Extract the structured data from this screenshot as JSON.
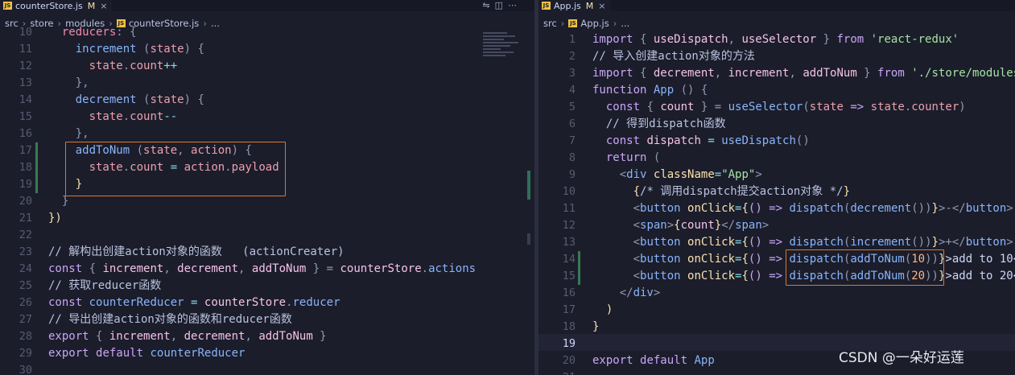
{
  "left": {
    "tab": {
      "icon": "js-icon",
      "name": "counterStore.js",
      "modified": "M",
      "close": "×"
    },
    "breadcrumb": [
      "src",
      "store",
      "modules",
      "counterStore.js",
      "..."
    ],
    "lines": [
      {
        "n": "10",
        "tokens": [
          [
            "  ",
            "t-txt"
          ],
          [
            "reducers",
            "t-obj"
          ],
          [
            ": {",
            "t-pn"
          ]
        ]
      },
      {
        "n": "11",
        "tokens": [
          [
            "    ",
            "t-txt"
          ],
          [
            "increment",
            "t-fn"
          ],
          [
            " (",
            "t-pn"
          ],
          [
            "state",
            "t-param"
          ],
          [
            ") {",
            "t-pn"
          ]
        ]
      },
      {
        "n": "12",
        "tokens": [
          [
            "      ",
            "t-txt"
          ],
          [
            "state",
            "t-param"
          ],
          [
            ".",
            "t-pn"
          ],
          [
            "count",
            "t-param"
          ],
          [
            "++",
            "t-op"
          ]
        ]
      },
      {
        "n": "13",
        "tokens": [
          [
            "    },",
            "t-pn"
          ]
        ]
      },
      {
        "n": "14",
        "tokens": [
          [
            "    ",
            "t-txt"
          ],
          [
            "decrement",
            "t-fn"
          ],
          [
            " (",
            "t-pn"
          ],
          [
            "state",
            "t-param"
          ],
          [
            ") {",
            "t-pn"
          ]
        ]
      },
      {
        "n": "15",
        "tokens": [
          [
            "      ",
            "t-txt"
          ],
          [
            "state",
            "t-param"
          ],
          [
            ".",
            "t-pn"
          ],
          [
            "count",
            "t-param"
          ],
          [
            "--",
            "t-op"
          ]
        ]
      },
      {
        "n": "16",
        "tokens": [
          [
            "    },",
            "t-pn"
          ]
        ]
      },
      {
        "n": "17",
        "tokens": [
          [
            "    ",
            "t-txt"
          ],
          [
            "addToNum",
            "t-fn"
          ],
          [
            " (",
            "t-pn"
          ],
          [
            "state",
            "t-param"
          ],
          [
            ", ",
            "t-pn"
          ],
          [
            "action",
            "t-param"
          ],
          [
            ") {",
            "t-pn"
          ]
        ]
      },
      {
        "n": "18",
        "tokens": [
          [
            "      ",
            "t-txt"
          ],
          [
            "state",
            "t-param"
          ],
          [
            ".",
            "t-pn"
          ],
          [
            "count",
            "t-param"
          ],
          [
            " = ",
            "t-op"
          ],
          [
            "action",
            "t-param"
          ],
          [
            ".",
            "t-pn"
          ],
          [
            "payload",
            "t-param"
          ]
        ]
      },
      {
        "n": "19",
        "tokens": [
          [
            "    }",
            "t-br"
          ]
        ]
      },
      {
        "n": "20",
        "tokens": [
          [
            "  }",
            "t-pn"
          ]
        ]
      },
      {
        "n": "21",
        "tokens": [
          [
            "})",
            "t-br"
          ]
        ]
      },
      {
        "n": "22",
        "tokens": []
      },
      {
        "n": "23",
        "tokens": [
          [
            "// 解构出创建action对象的函数   (actionCreater)",
            "t-cmt"
          ]
        ]
      },
      {
        "n": "24",
        "tokens": [
          [
            "const",
            "t-kw"
          ],
          [
            " { ",
            "t-pn"
          ],
          [
            "increment",
            "t-var"
          ],
          [
            ", ",
            "t-pn"
          ],
          [
            "decrement",
            "t-var"
          ],
          [
            ", ",
            "t-pn"
          ],
          [
            "addToNum",
            "t-var"
          ],
          [
            " } = ",
            "t-pn"
          ],
          [
            "counterStore",
            "t-var"
          ],
          [
            ".",
            "t-pn"
          ],
          [
            "actions",
            "t-prop"
          ]
        ]
      },
      {
        "n": "25",
        "tokens": [
          [
            "// 获取reducer函数",
            "t-cmt"
          ]
        ]
      },
      {
        "n": "26",
        "tokens": [
          [
            "const",
            "t-kw"
          ],
          [
            " ",
            "t-txt"
          ],
          [
            "counterReducer",
            "t-fn"
          ],
          [
            " = ",
            "t-op"
          ],
          [
            "counterStore",
            "t-var"
          ],
          [
            ".",
            "t-pn"
          ],
          [
            "reducer",
            "t-prop"
          ]
        ]
      },
      {
        "n": "27",
        "tokens": [
          [
            "// 导出创建action对象的函数和reducer函数",
            "t-cmt"
          ]
        ]
      },
      {
        "n": "28",
        "tokens": [
          [
            "export",
            "t-kw"
          ],
          [
            " { ",
            "t-pn"
          ],
          [
            "increment",
            "t-var"
          ],
          [
            ", ",
            "t-pn"
          ],
          [
            "decrement",
            "t-var"
          ],
          [
            ", ",
            "t-pn"
          ],
          [
            "addToNum",
            "t-var"
          ],
          [
            " }",
            "t-pn"
          ]
        ]
      },
      {
        "n": "29",
        "tokens": [
          [
            "export",
            "t-kw"
          ],
          [
            " ",
            "t-txt"
          ],
          [
            "default",
            "t-kw"
          ],
          [
            " ",
            "t-txt"
          ],
          [
            "counterReducer",
            "t-fn"
          ]
        ]
      },
      {
        "n": "30",
        "tokens": []
      }
    ]
  },
  "right": {
    "tab": {
      "icon": "js-icon",
      "name": "App.js",
      "modified": "M",
      "close": "×"
    },
    "breadcrumb": [
      "src",
      "App.js",
      "..."
    ],
    "lines": [
      {
        "n": "1",
        "tokens": [
          [
            "import",
            "t-kw"
          ],
          [
            " { ",
            "t-pn"
          ],
          [
            "useDispatch",
            "t-var"
          ],
          [
            ", ",
            "t-pn"
          ],
          [
            "useSelector",
            "t-var"
          ],
          [
            " } ",
            "t-pn"
          ],
          [
            "from",
            "t-kw"
          ],
          [
            " ",
            "t-txt"
          ],
          [
            "'react-redux'",
            "t-str"
          ]
        ]
      },
      {
        "n": "2",
        "tokens": [
          [
            "// 导入创建action对象的方法",
            "t-cmt"
          ]
        ]
      },
      {
        "n": "3",
        "tokens": [
          [
            "import",
            "t-kw"
          ],
          [
            " { ",
            "t-pn"
          ],
          [
            "decrement",
            "t-var"
          ],
          [
            ", ",
            "t-pn"
          ],
          [
            "increment",
            "t-var"
          ],
          [
            ", ",
            "t-pn"
          ],
          [
            "addToNum",
            "t-var"
          ],
          [
            " } ",
            "t-pn"
          ],
          [
            "from",
            "t-kw"
          ],
          [
            " ",
            "t-txt"
          ],
          [
            "'./store/modules",
            "t-str"
          ]
        ]
      },
      {
        "n": "4",
        "tokens": [
          [
            "function",
            "t-kw"
          ],
          [
            " ",
            "t-txt"
          ],
          [
            "App",
            "t-fn"
          ],
          [
            " () {",
            "t-pn"
          ]
        ]
      },
      {
        "n": "5",
        "tokens": [
          [
            "  ",
            "t-txt"
          ],
          [
            "const",
            "t-kw"
          ],
          [
            " { ",
            "t-pn"
          ],
          [
            "count",
            "t-var"
          ],
          [
            " } = ",
            "t-pn"
          ],
          [
            "useSelector",
            "t-fn"
          ],
          [
            "(",
            "t-pn"
          ],
          [
            "state",
            "t-param"
          ],
          [
            " => ",
            "t-kw"
          ],
          [
            "state",
            "t-param"
          ],
          [
            ".",
            "t-pn"
          ],
          [
            "counter",
            "t-param"
          ],
          [
            ")",
            "t-pn"
          ]
        ]
      },
      {
        "n": "6",
        "tokens": [
          [
            "  // 得到dispatch函数",
            "t-cmt"
          ]
        ]
      },
      {
        "n": "7",
        "tokens": [
          [
            "  ",
            "t-txt"
          ],
          [
            "const",
            "t-kw"
          ],
          [
            " ",
            "t-txt"
          ],
          [
            "dispatch",
            "t-var"
          ],
          [
            " = ",
            "t-op"
          ],
          [
            "useDispatch",
            "t-fn"
          ],
          [
            "()",
            "t-pn"
          ]
        ]
      },
      {
        "n": "8",
        "tokens": [
          [
            "  ",
            "t-txt"
          ],
          [
            "return",
            "t-kw"
          ],
          [
            " (",
            "t-pn"
          ]
        ]
      },
      {
        "n": "9",
        "tokens": [
          [
            "    <",
            "t-pn"
          ],
          [
            "div",
            "t-tag"
          ],
          [
            " ",
            "t-txt"
          ],
          [
            "className",
            "t-attr"
          ],
          [
            "=",
            "t-op"
          ],
          [
            "\"App\"",
            "t-str"
          ],
          [
            ">",
            "t-pn"
          ]
        ]
      },
      {
        "n": "10",
        "tokens": [
          [
            "      {",
            "t-br"
          ],
          [
            "/* 调用dispatch提交action对象 */",
            "t-cmt"
          ],
          [
            "}",
            "t-br"
          ]
        ]
      },
      {
        "n": "11",
        "tokens": [
          [
            "      <",
            "t-pn"
          ],
          [
            "button",
            "t-tag"
          ],
          [
            " ",
            "t-txt"
          ],
          [
            "onClick",
            "t-attr"
          ],
          [
            "=",
            "t-op"
          ],
          [
            "{",
            "t-br"
          ],
          [
            "() => ",
            "t-kw"
          ],
          [
            "dispatch",
            "t-fn"
          ],
          [
            "(",
            "t-pn"
          ],
          [
            "decrement",
            "t-fn"
          ],
          [
            "()",
            "t-pn"
          ],
          [
            ")",
            "t-pn"
          ],
          [
            "}",
            "t-br"
          ],
          [
            ">-</",
            "t-pn"
          ],
          [
            "button",
            "t-tag"
          ],
          [
            ">",
            "t-pn"
          ]
        ]
      },
      {
        "n": "12",
        "tokens": [
          [
            "      <",
            "t-pn"
          ],
          [
            "span",
            "t-tag"
          ],
          [
            ">",
            "t-pn"
          ],
          [
            "{",
            "t-br"
          ],
          [
            "count",
            "t-var"
          ],
          [
            "}",
            "t-br"
          ],
          [
            "</",
            "t-pn"
          ],
          [
            "span",
            "t-tag"
          ],
          [
            ">",
            "t-pn"
          ]
        ]
      },
      {
        "n": "13",
        "tokens": [
          [
            "      <",
            "t-pn"
          ],
          [
            "button",
            "t-tag"
          ],
          [
            " ",
            "t-txt"
          ],
          [
            "onClick",
            "t-attr"
          ],
          [
            "=",
            "t-op"
          ],
          [
            "{",
            "t-br"
          ],
          [
            "() => ",
            "t-kw"
          ],
          [
            "dispatch",
            "t-fn"
          ],
          [
            "(",
            "t-pn"
          ],
          [
            "increment",
            "t-fn"
          ],
          [
            "()",
            "t-pn"
          ],
          [
            ")",
            "t-pn"
          ],
          [
            "}",
            "t-br"
          ],
          [
            ">+</",
            "t-pn"
          ],
          [
            "button",
            "t-tag"
          ],
          [
            ">",
            "t-pn"
          ]
        ]
      },
      {
        "n": "14",
        "tokens": [
          [
            "      <",
            "t-pn"
          ],
          [
            "button",
            "t-tag"
          ],
          [
            " ",
            "t-txt"
          ],
          [
            "onClick",
            "t-attr"
          ],
          [
            "=",
            "t-op"
          ],
          [
            "{",
            "t-br"
          ],
          [
            "() => ",
            "t-kw"
          ],
          [
            "dispatch",
            "t-fn"
          ],
          [
            "(",
            "t-pn"
          ],
          [
            "addToNum",
            "t-fn"
          ],
          [
            "(",
            "t-pn"
          ],
          [
            "10",
            "t-num"
          ],
          [
            ")",
            "t-pn"
          ],
          [
            ")",
            "t-pn"
          ],
          [
            "}",
            "t-br"
          ],
          [
            ">add to 10<",
            "t-txt"
          ]
        ]
      },
      {
        "n": "15",
        "tokens": [
          [
            "      <",
            "t-pn"
          ],
          [
            "button",
            "t-tag"
          ],
          [
            " ",
            "t-txt"
          ],
          [
            "onClick",
            "t-attr"
          ],
          [
            "=",
            "t-op"
          ],
          [
            "{",
            "t-br"
          ],
          [
            "() => ",
            "t-kw"
          ],
          [
            "dispatch",
            "t-fn"
          ],
          [
            "(",
            "t-pn"
          ],
          [
            "addToNum",
            "t-fn"
          ],
          [
            "(",
            "t-pn"
          ],
          [
            "20",
            "t-num"
          ],
          [
            ")",
            "t-pn"
          ],
          [
            ")",
            "t-pn"
          ],
          [
            "}",
            "t-br"
          ],
          [
            ">add to 20<",
            "t-txt"
          ]
        ]
      },
      {
        "n": "16",
        "tokens": [
          [
            "    </",
            "t-pn"
          ],
          [
            "div",
            "t-tag"
          ],
          [
            ">",
            "t-pn"
          ]
        ]
      },
      {
        "n": "17",
        "tokens": [
          [
            "  )",
            "t-br"
          ]
        ]
      },
      {
        "n": "18",
        "tokens": [
          [
            "}",
            "t-br"
          ]
        ]
      },
      {
        "n": "19",
        "tokens": []
      },
      {
        "n": "20",
        "tokens": [
          [
            "export",
            "t-kw"
          ],
          [
            " ",
            "t-txt"
          ],
          [
            "default",
            "t-kw"
          ],
          [
            " ",
            "t-txt"
          ],
          [
            "App",
            "t-fn"
          ]
        ]
      },
      {
        "n": "21",
        "tokens": []
      }
    ]
  },
  "watermark": "CSDN @一朵好运莲"
}
